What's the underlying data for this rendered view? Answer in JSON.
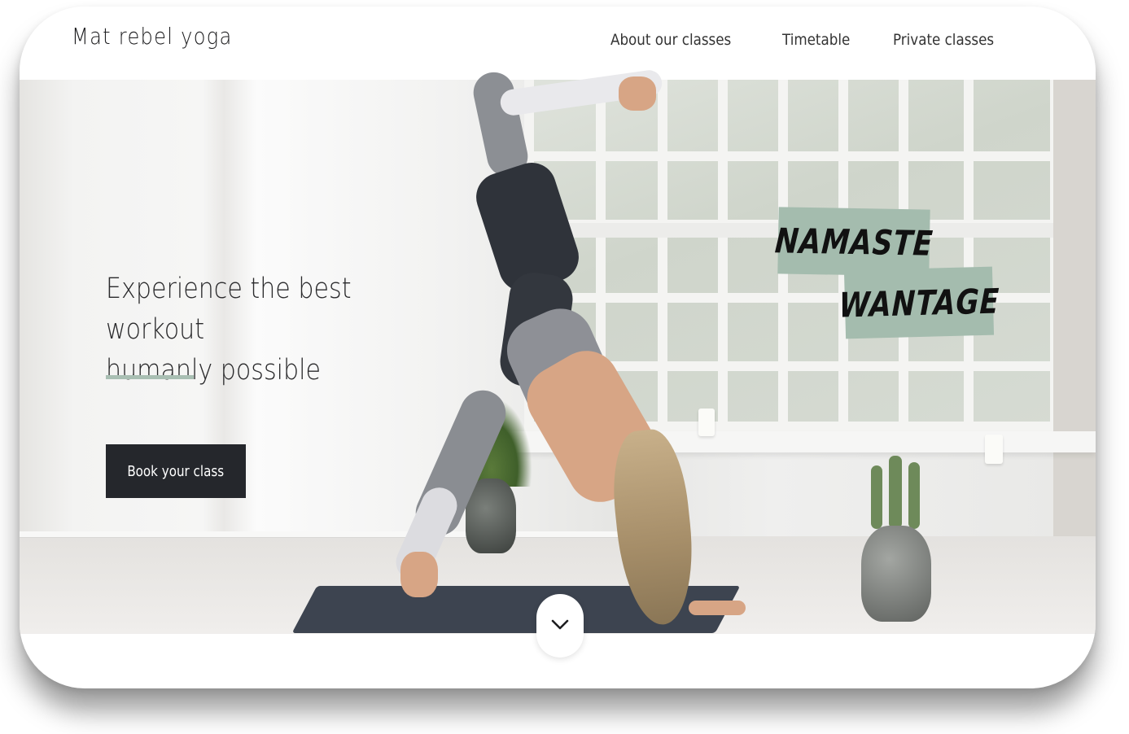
{
  "header": {
    "logo": "Mat rebel yoga",
    "nav": [
      "About our classes",
      "Timetable",
      "Private classes"
    ]
  },
  "hero": {
    "headline_line1": "Experience the best workout",
    "headline_line2": "humanly possible",
    "cta_label": "Book your class",
    "sticker_line1": "NAMASTE",
    "sticker_line2": "WANTAGE",
    "scroll_icon": "chevron-down-icon"
  },
  "colors": {
    "accent": "#a9bfb3",
    "sticker": "#a4bcae",
    "cta_bg": "#25272c",
    "text": "#2a2a2c"
  }
}
